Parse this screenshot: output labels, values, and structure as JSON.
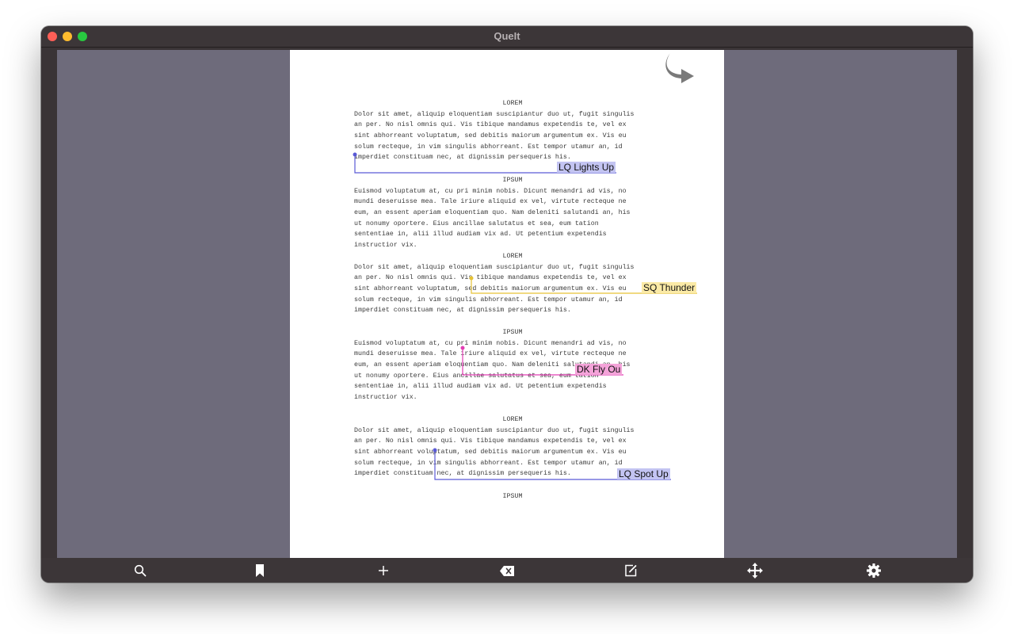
{
  "window": {
    "title": "QueIt"
  },
  "script": {
    "blocks": [
      {
        "heading": "LOREM",
        "lines": [
          "Dolor sit amet, aliquip eloquentiam suscipiantur duo ut, fugit singulis",
          "an per. No nisl omnis qui. Vis tibique mandamus expetendis te, vel ex",
          "sint abhorreant voluptatum, sed debitis maiorum argumentum ex. Vis eu",
          "solum recteque, in vim singulis abhorreant. Est tempor utamur an, id",
          "imperdiet constituam nec, at dignissim persequeris his."
        ]
      },
      {
        "heading": "IPSUM",
        "lines": [
          "Euismod voluptatum at, cu pri minim nobis. Dicunt menandri ad vis, no",
          "mundi deseruisse mea. Tale iriure aliquid ex vel, virtute recteque ne",
          "eum, an essent aperiam eloquentiam quo. Nam deleniti salutandi an, his",
          "ut nonumy oportere. Eius ancillae salutatus et sea, eum tation",
          "sententiae in, alii illud audiam vix ad. Ut petentium expetendis",
          "instructior vix."
        ]
      },
      {
        "heading": "LOREM",
        "lines": [
          "Dolor sit amet, aliquip eloquentiam suscipiantur duo ut, fugit singulis",
          "an per. No nisl omnis qui. Vis tibique mandamus expetendis te, vel ex",
          "sint abhorreant voluptatum, sed debitis maiorum argumentum ex. Vis eu",
          "solum recteque, in vim singulis abhorreant. Est tempor utamur an, id",
          "imperdiet constituam nec, at dignissim persequeris his."
        ]
      },
      {
        "heading": "IPSUM",
        "lines": [
          "Euismod voluptatum at, cu pri minim nobis. Dicunt menandri ad vis, no",
          "mundi deseruisse mea. Tale iriure aliquid ex vel, virtute recteque ne",
          "eum, an essent aperiam eloquentiam quo. Nam deleniti salutandi an, his",
          "ut nonumy oportere. Eius ancillae salutatus et sea, eum tation",
          "sententiae in, alii illud audiam vix ad. Ut petentium expetendis",
          "instructior vix."
        ]
      },
      {
        "heading": "LOREM",
        "lines": [
          "Dolor sit amet, aliquip eloquentiam suscipiantur duo ut, fugit singulis",
          "an per. No nisl omnis qui. Vis tibique mandamus expetendis te, vel ex",
          "sint abhorreant voluptatum, sed debitis maiorum argumentum ex. Vis eu",
          "solum recteque, in vim singulis abhorreant. Est tempor utamur an, id",
          "imperdiet constituam nec, at dignissim persequeris his."
        ]
      },
      {
        "heading": "IPSUM",
        "lines": []
      }
    ]
  },
  "cues": [
    {
      "label": "LQ Lights Up",
      "color": "#5a5ad6"
    },
    {
      "label": "SQ Thunder",
      "color": "#e6c235"
    },
    {
      "label": "DK Fly Ou",
      "color": "#e23db3"
    },
    {
      "label": "LQ Spot Up",
      "color": "#5a5ad6"
    }
  ],
  "toolbar": {
    "items": [
      {
        "icon": "search-icon"
      },
      {
        "icon": "bookmark-icon"
      },
      {
        "icon": "plus-icon"
      },
      {
        "icon": "delete-icon"
      },
      {
        "icon": "edit-icon"
      },
      {
        "icon": "move-icon"
      },
      {
        "icon": "gear-icon"
      }
    ]
  }
}
